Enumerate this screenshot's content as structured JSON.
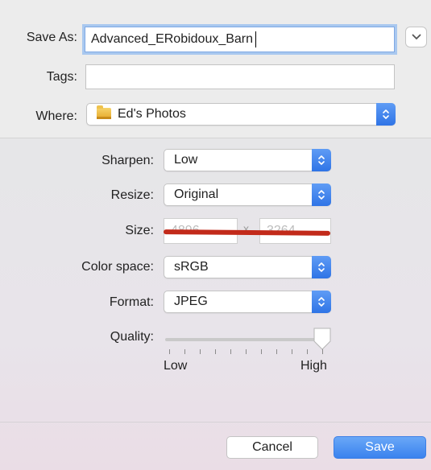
{
  "save_as": {
    "label": "Save As:",
    "value": "Advanced_ERobidoux_Barn"
  },
  "tags": {
    "label": "Tags:",
    "value": ""
  },
  "where": {
    "label": "Where:",
    "value": "Ed's Photos",
    "icon": "folder-icon"
  },
  "options": {
    "sharpen": {
      "label": "Sharpen:",
      "value": "Low"
    },
    "resize": {
      "label": "Resize:",
      "value": "Original"
    },
    "size": {
      "label": "Size:",
      "width": "4896",
      "separator": "x",
      "height": "3264"
    },
    "color_space": {
      "label": "Color space:",
      "value": "sRGB"
    },
    "format": {
      "label": "Format:",
      "value": "JPEG"
    },
    "quality": {
      "label": "Quality:",
      "min_label": "Low",
      "max_label": "High",
      "level": 0.95
    }
  },
  "buttons": {
    "cancel": "Cancel",
    "save": "Save"
  },
  "colors": {
    "accent": "#3a82ee",
    "strike": "#c22a1a"
  }
}
